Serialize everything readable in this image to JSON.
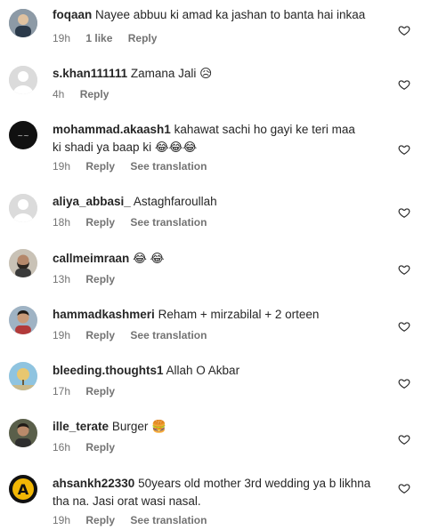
{
  "comments": [
    {
      "username": "foqaan",
      "text": "Nayee abbuu ki amad ka jashan to banta hai inkaa",
      "time": "19h",
      "likes": "1 like",
      "reply": "Reply",
      "translation": ""
    },
    {
      "username": "s.khan111111",
      "text": "Zamana Jali 😥",
      "time": "4h",
      "likes": "",
      "reply": "Reply",
      "translation": ""
    },
    {
      "username": "mohammad.akaash1",
      "text": "kahawat sachi ho gayi ke teri maa ki shadi ya baap ki 😂😂😂",
      "time": "19h",
      "likes": "",
      "reply": "Reply",
      "translation": "See translation"
    },
    {
      "username": "aliya_abbasi_",
      "text": "Astaghfaroullah",
      "time": "18h",
      "likes": "",
      "reply": "Reply",
      "translation": "See translation"
    },
    {
      "username": "callmeimraan",
      "text": "😂 😂",
      "time": "13h",
      "likes": "",
      "reply": "Reply",
      "translation": ""
    },
    {
      "username": "hammadkashmeri",
      "text": "Reham + mirzabilal + 2 orteen",
      "time": "19h",
      "likes": "",
      "reply": "Reply",
      "translation": "See translation"
    },
    {
      "username": "bleeding.thoughts1",
      "text": "Allah O Akbar",
      "time": "17h",
      "likes": "",
      "reply": "Reply",
      "translation": ""
    },
    {
      "username": "ille_terate",
      "text": "Burger 🍔",
      "time": "16h",
      "likes": "",
      "reply": "Reply",
      "translation": ""
    },
    {
      "username": "ahsankh22330",
      "text": "50years old mother 3rd wedding ya b likhna tha na. Jasi orat wasi nasal.",
      "time": "19h",
      "likes": "",
      "reply": "Reply",
      "translation": "See translation"
    }
  ],
  "icons": {
    "heart": "heart-outline-icon",
    "avatar_default": "default-avatar-icon"
  },
  "colors": {
    "text": "#262626",
    "meta": "#737373",
    "avatar_placeholder": "#dbdbdb"
  }
}
